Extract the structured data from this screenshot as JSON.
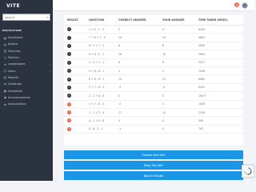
{
  "app": {
    "logo": "VITE"
  },
  "sidebar": {
    "search_value": "ABACUS",
    "heading": "NAVIGATION",
    "items": [
      {
        "label": "Dashboard",
        "icon": "dashboard-icon"
      },
      {
        "label": "Abakus",
        "icon": "abacus-icon"
      },
      {
        "label": "Formulas",
        "icon": "formula-icon"
      },
      {
        "label": "Practice",
        "icon": "practice-icon"
      },
      {
        "label": "Leaderboard",
        "icon": "leaderboard-icon"
      },
      {
        "label": "Users",
        "icon": "users-icon"
      },
      {
        "label": "Reports",
        "icon": "reports-icon"
      },
      {
        "label": "Challenge",
        "icon": "challenge-icon"
      },
      {
        "label": "Homework",
        "icon": "homework-icon"
      },
      {
        "label": "Announcements",
        "icon": "announcement-icon"
      },
      {
        "label": "Subscriptions",
        "icon": "subscription-icon"
      }
    ]
  },
  "topbar": {
    "notification_count": "2"
  },
  "table": {
    "headers": {
      "result": "RESULT",
      "question": "QUESTION",
      "correct": "CORRECT ANSWER",
      "your": "YOUR ANSWER",
      "time": "TIME TAKEN (MSEC)"
    },
    "rows": [
      {
        "result": "ok",
        "question": "1 + 0 - 1 - 2",
        "correct": "2",
        "your": "2",
        "time": "6309"
      },
      {
        "result": "ok",
        "question": "7 + 6 + 1 - 5",
        "correct": "10",
        "your": "10",
        "time": "4863"
      },
      {
        "result": "ok",
        "question": "6 - 2 + 7 - 2",
        "correct": "8",
        "your": "8",
        "time": "4090"
      },
      {
        "result": "ok",
        "question": "8 + 8 - 2 - 7",
        "correct": "16",
        "your": "16",
        "time": "3950"
      },
      {
        "result": "ok",
        "question": "5 - 2 + 5 - 1",
        "correct": "8",
        "your": "8",
        "time": "3037"
      },
      {
        "result": "ok",
        "question": "9 + 6 - 8 - 1",
        "correct": "4",
        "your": "4",
        "time": "7558"
      },
      {
        "result": "ok",
        "question": "6 + 6 - 8 - 1",
        "correct": "13",
        "your": "13",
        "time": "6860"
      },
      {
        "result": "ok",
        "question": "2 + 7 - 8 - 5",
        "correct": "-4",
        "your": "-4",
        "time": "6303"
      },
      {
        "result": "ok",
        "question": "2 - 2 + 8 - 8",
        "correct": "0",
        "your": "0",
        "time": "10077"
      },
      {
        "result": "bad",
        "question": "1 + 7 - 8 - 2",
        "correct": "-2",
        "your": "0",
        "time": "1058"
      },
      {
        "result": "bad",
        "question": "7 - 2 + 2 - 4",
        "correct": "17",
        "your": "10",
        "time": "1226"
      },
      {
        "result": "bad",
        "question": "4 - 1 + 5 - 8",
        "correct": "2",
        "your": "0",
        "time": "540"
      },
      {
        "result": "bad",
        "question": "8 - 8 - 2 - 1",
        "correct": "-1",
        "your": "0",
        "time": "767"
      }
    ]
  },
  "actions": {
    "practice_next": "Practice Next Set?",
    "retry": "Retry This Set?",
    "back": "Back to Results"
  }
}
